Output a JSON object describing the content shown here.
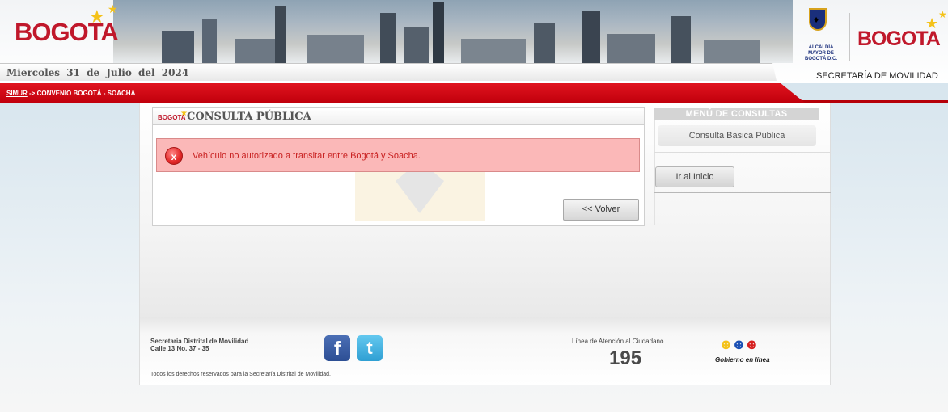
{
  "header": {
    "logo_left": "BOGOTA",
    "date": "Miercoles 31 de Julio del 2024",
    "alcaldia": "ALCALDÍA MAYOR DE BOGOTÁ D.C.",
    "logo_right": "BOGOTA",
    "secretaria": "SECRETARÍA DE MOVILIDAD"
  },
  "breadcrumb": {
    "link": "SIMUR",
    "rest": " -> CONVENIO BOGOTÁ - SOACHA"
  },
  "panel": {
    "mini_logo": "BOGOTA",
    "title": "CONSULTA PÚBLICA",
    "error_icon": "x",
    "error_message": "Vehículo no autorizado a transitar entre Bogotá y Soacha.",
    "back_button": "<< Volver"
  },
  "menu": {
    "heading": "MENÚ DE CONSULTAS",
    "items": [
      {
        "label": "Consulta Basica Pública"
      }
    ],
    "home_button": "Ir al Inicio"
  },
  "footer": {
    "org_name": "Secretaria Distrital de Movilidad",
    "address": "Calle 13 No. 37 - 35",
    "rights": "Todos los derechos reservados para la Secretaría Distrital de Movilidad.",
    "facebook_glyph": "f",
    "twitter_glyph": "t",
    "line_label": "Línea de Atención al Ciudadano",
    "line_number": "195",
    "gob_text": "Gobierno en línea"
  },
  "colors": {
    "brand_red": "#c0182b",
    "star_yellow": "#f4c219",
    "error_bg": "#fbb8b8",
    "error_text": "#c82020"
  },
  "icons": [
    "star-icon",
    "shield-icon",
    "error-icon",
    "facebook-icon",
    "twitter-icon",
    "gobierno-en-linea-icon"
  ]
}
